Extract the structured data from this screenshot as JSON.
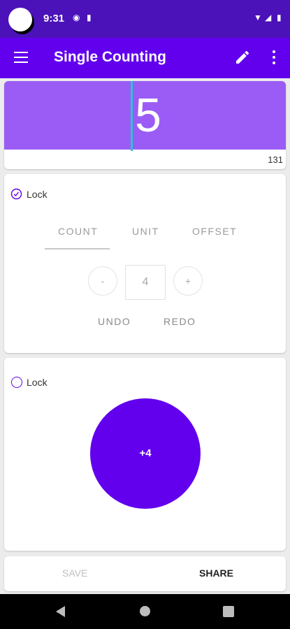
{
  "status_bar": {
    "time": "9:31",
    "icons": [
      "notification-icon",
      "sd-card-icon",
      "wifi-icon",
      "signal-icon",
      "battery-icon"
    ]
  },
  "app_bar": {
    "title": "Single Counting",
    "icons": [
      "menu-icon",
      "pencil-icon",
      "more-vert-icon"
    ]
  },
  "counter": {
    "value": "5",
    "total": "131"
  },
  "control_panel": {
    "lock_label": "Lock",
    "tabs": [
      {
        "label": "COUNT",
        "selected": true
      },
      {
        "label": "UNIT",
        "selected": false
      },
      {
        "label": "OFFSET",
        "selected": false
      }
    ],
    "decrement_label": "-",
    "increment_label": "+",
    "step_value": "4",
    "undo_label": "UNDO",
    "redo_label": "REDO"
  },
  "tap_panel": {
    "lock_label": "Lock",
    "tap_button_label": "+4"
  },
  "actions": {
    "save_label": "SAVE",
    "share_label": "SHARE"
  },
  "colors": {
    "primary": "#6200ee",
    "status_bar": "#4a12b8",
    "display": "#9b5cf5",
    "cursor": "#27c4d6"
  }
}
